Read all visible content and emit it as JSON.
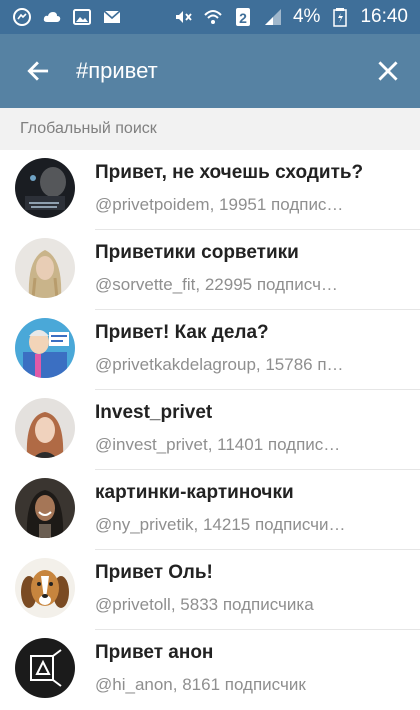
{
  "status_bar": {
    "battery_percent": "4%",
    "time": "16:40",
    "sim_label": "2",
    "left_icons": [
      "messenger-icon",
      "cloud-icon",
      "gallery-icon",
      "mail-icon"
    ],
    "right_icons": [
      "mute-icon",
      "wifi-icon",
      "sim-icon",
      "signal-icon",
      "battery-icon"
    ]
  },
  "toolbar": {
    "search_query": "#привет",
    "colors": {
      "status_bar": "#3f6f99",
      "toolbar": "#5682a3"
    }
  },
  "section": {
    "header": "Глобальный поиск"
  },
  "results": [
    {
      "title": "Привет, не хочешь сходить?",
      "subtitle": "@privetpoidem, 19951 подпис…",
      "avatar": "dark-photo-avatar"
    },
    {
      "title": "Приветики сорветики",
      "subtitle": "@sorvette_fit, 22995 подписч…",
      "avatar": "blonde-girl-avatar"
    },
    {
      "title": "Привет! Как дела?",
      "subtitle": "@privetkakdelagroup, 15786 п…",
      "avatar": "cartoon-avatar"
    },
    {
      "title": "Invest_privet",
      "subtitle": "@invest_privet, 11401 подпис…",
      "avatar": "woman-portrait-avatar"
    },
    {
      "title": "картинки-картиночки",
      "subtitle": "@ny_privetik, 14215 подписчи…",
      "avatar": "smiling-girl-avatar"
    },
    {
      "title": "Привет Оль!",
      "subtitle": "@privetoll, 5833 подписчика",
      "avatar": "beagle-dog-avatar"
    },
    {
      "title": "Привет анон",
      "subtitle": "@hi_anon, 8161 подписчик",
      "avatar": "graphic-avatar"
    }
  ]
}
